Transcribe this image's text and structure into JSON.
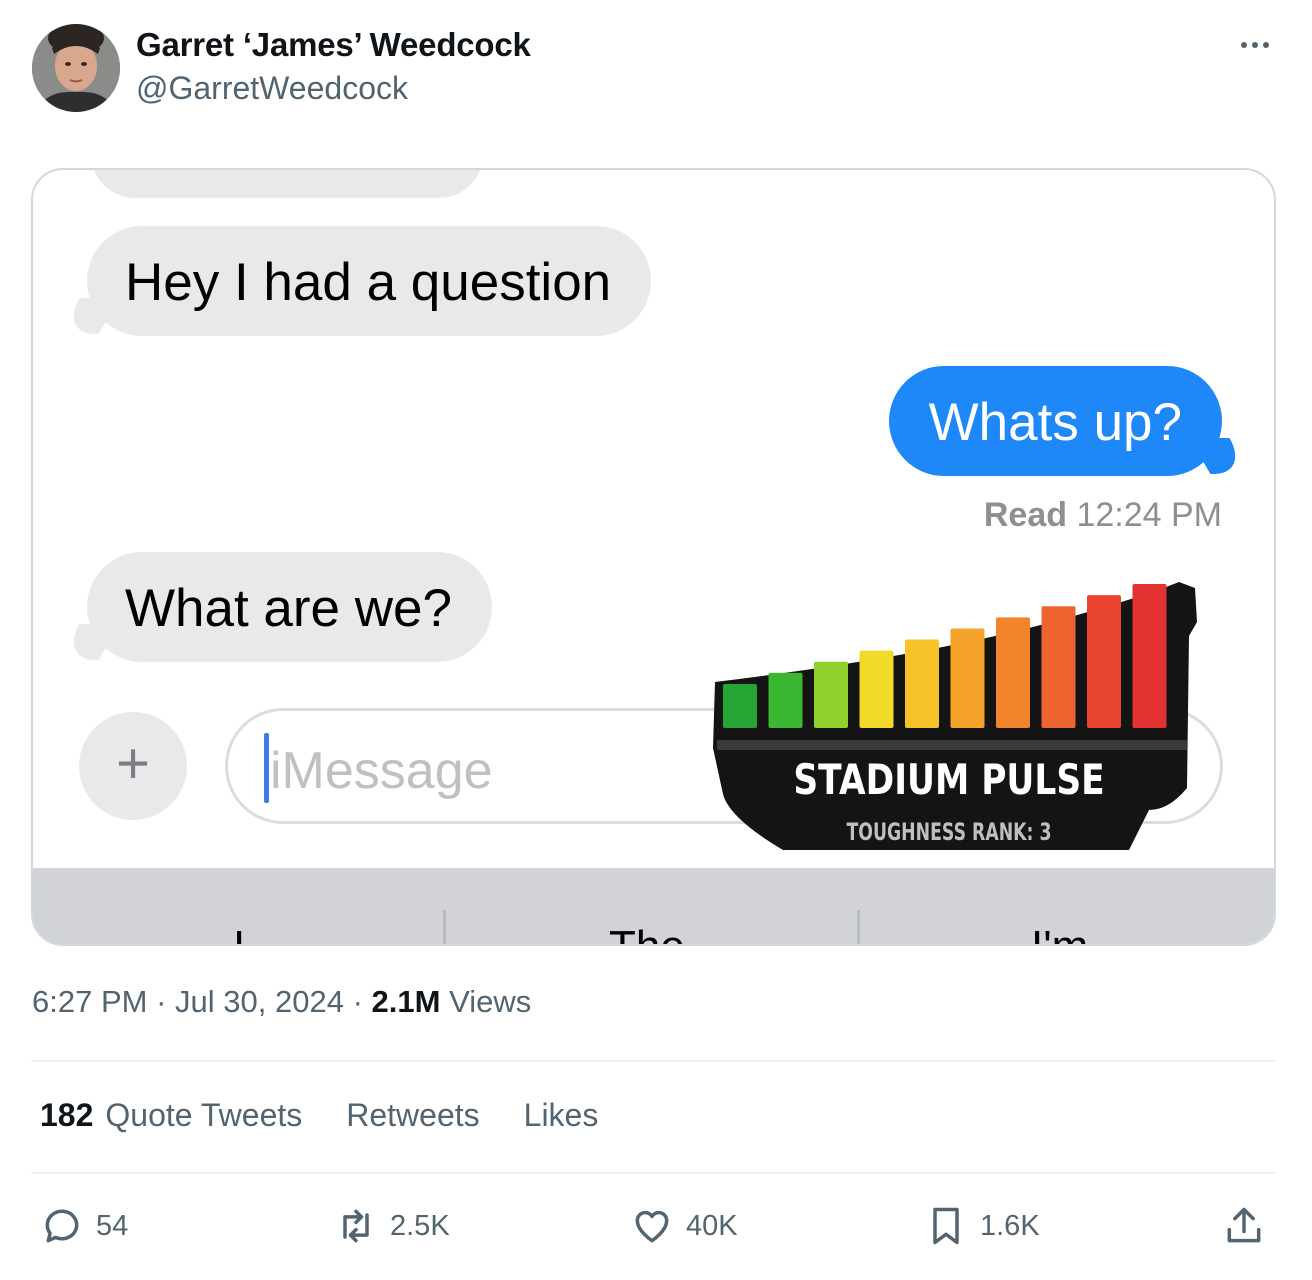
{
  "author": {
    "display_name": "Garret ‘James’ Weedcock",
    "handle": "@GarretWeedcock"
  },
  "media": {
    "messages": [
      {
        "direction": "incoming",
        "text": "Hey I had a question"
      },
      {
        "direction": "outgoing",
        "text": "Whats up?"
      },
      {
        "direction": "incoming",
        "text": "What are we?"
      }
    ],
    "read_receipt": {
      "label": "Read",
      "time": "12:24 PM"
    },
    "input_placeholder": "iMessage",
    "keyboard_suggestions": [
      "I",
      "The",
      "I'm"
    ],
    "sticker": {
      "title": "STADIUM PULSE",
      "subtitle": "TOUGHNESS RANK: 3",
      "meter_colors": [
        "#27a534",
        "#3cb731",
        "#8fd12a",
        "#f2da2a",
        "#f6c42a",
        "#f5a32a",
        "#f2852c",
        "#ee6430",
        "#e94431",
        "#e23232"
      ]
    }
  },
  "meta": {
    "time": "6:27 PM",
    "separator": "·",
    "date": "Jul 30, 2024",
    "views_count": "2.1M",
    "views_label": "Views"
  },
  "stats": {
    "quote_count": "182",
    "quote_label": "Quote Tweets",
    "retweets_label": "Retweets",
    "likes_label": "Likes"
  },
  "actions": {
    "replies": "54",
    "retweets": "2.5K",
    "likes": "40K",
    "bookmarks": "1.6K"
  },
  "colors": {
    "imessage_blue": "#1e88f9",
    "incoming_bubble": "#e9e9eb",
    "secondary_text": "#536471"
  }
}
